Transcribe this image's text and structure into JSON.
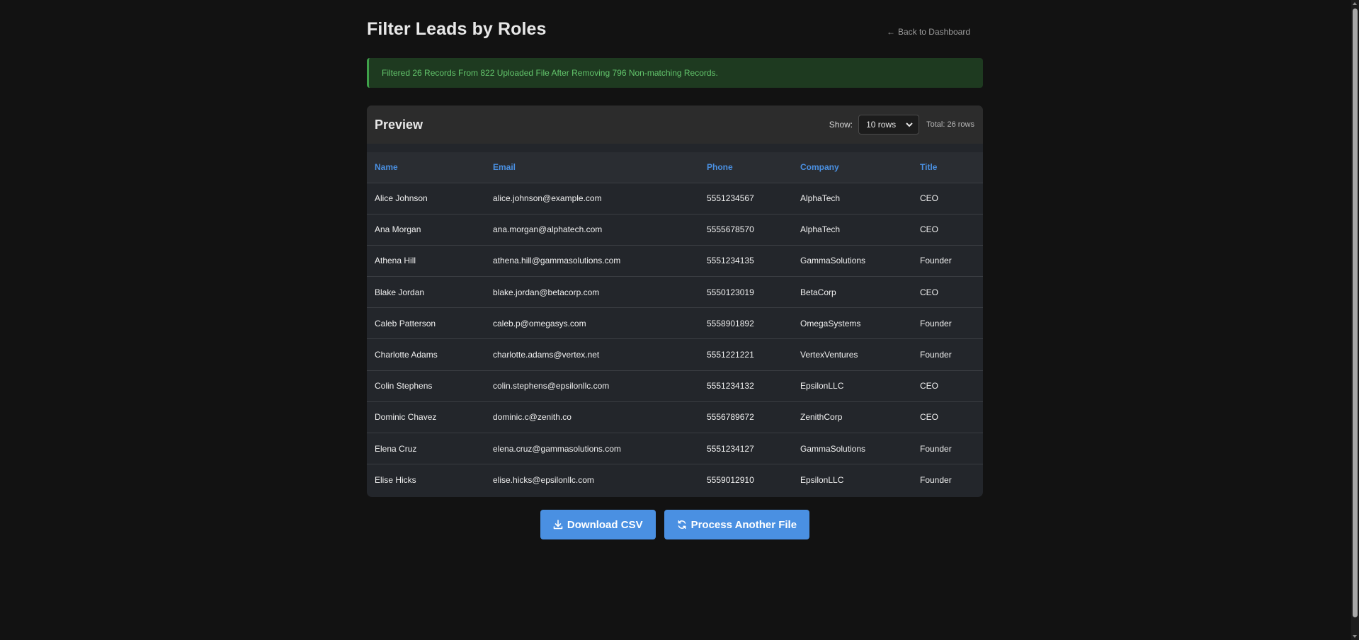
{
  "page": {
    "title": "Filter Leads by Roles",
    "back_label": "Back to Dashboard"
  },
  "alert": {
    "message": "Filtered 26 Records From 822 Uploaded File After Removing 796 Non-matching Records."
  },
  "preview": {
    "title": "Preview",
    "show_label": "Show:",
    "rows_selected": "10 rows",
    "total_label": "Total: 26 rows"
  },
  "table": {
    "columns": [
      "Name",
      "Email",
      "Phone",
      "Company",
      "Title"
    ],
    "rows": [
      [
        "Alice Johnson",
        "alice.johnson@example.com",
        "5551234567",
        "AlphaTech",
        "CEO"
      ],
      [
        "Ana Morgan",
        "ana.morgan@alphatech.com",
        "5555678570",
        "AlphaTech",
        "CEO"
      ],
      [
        "Athena Hill",
        "athena.hill@gammasolutions.com",
        "5551234135",
        "GammaSolutions",
        "Founder"
      ],
      [
        "Blake Jordan",
        "blake.jordan@betacorp.com",
        "5550123019",
        "BetaCorp",
        "CEO"
      ],
      [
        "Caleb Patterson",
        "caleb.p@omegasys.com",
        "5558901892",
        "OmegaSystems",
        "Founder"
      ],
      [
        "Charlotte Adams",
        "charlotte.adams@vertex.net",
        "5551221221",
        "VertexVentures",
        "Founder"
      ],
      [
        "Colin Stephens",
        "colin.stephens@epsilonllc.com",
        "5551234132",
        "EpsilonLLC",
        "CEO"
      ],
      [
        "Dominic Chavez",
        "dominic.c@zenith.co",
        "5556789672",
        "ZenithCorp",
        "CEO"
      ],
      [
        "Elena Cruz",
        "elena.cruz@gammasolutions.com",
        "5551234127",
        "GammaSolutions",
        "Founder"
      ],
      [
        "Elise Hicks",
        "elise.hicks@epsilonllc.com",
        "5559012910",
        "EpsilonLLC",
        "Founder"
      ]
    ]
  },
  "actions": {
    "download_label": "Download CSV",
    "process_label": "Process Another File"
  },
  "icons": {
    "back": "arrow-left-icon",
    "download": "download-icon",
    "process": "refresh-icon",
    "select": "chevron-down-icon"
  },
  "colors": {
    "accent": "#4a90e2",
    "success_text": "#63c56c",
    "success_bg": "#1e3a20",
    "background": "#121212"
  }
}
